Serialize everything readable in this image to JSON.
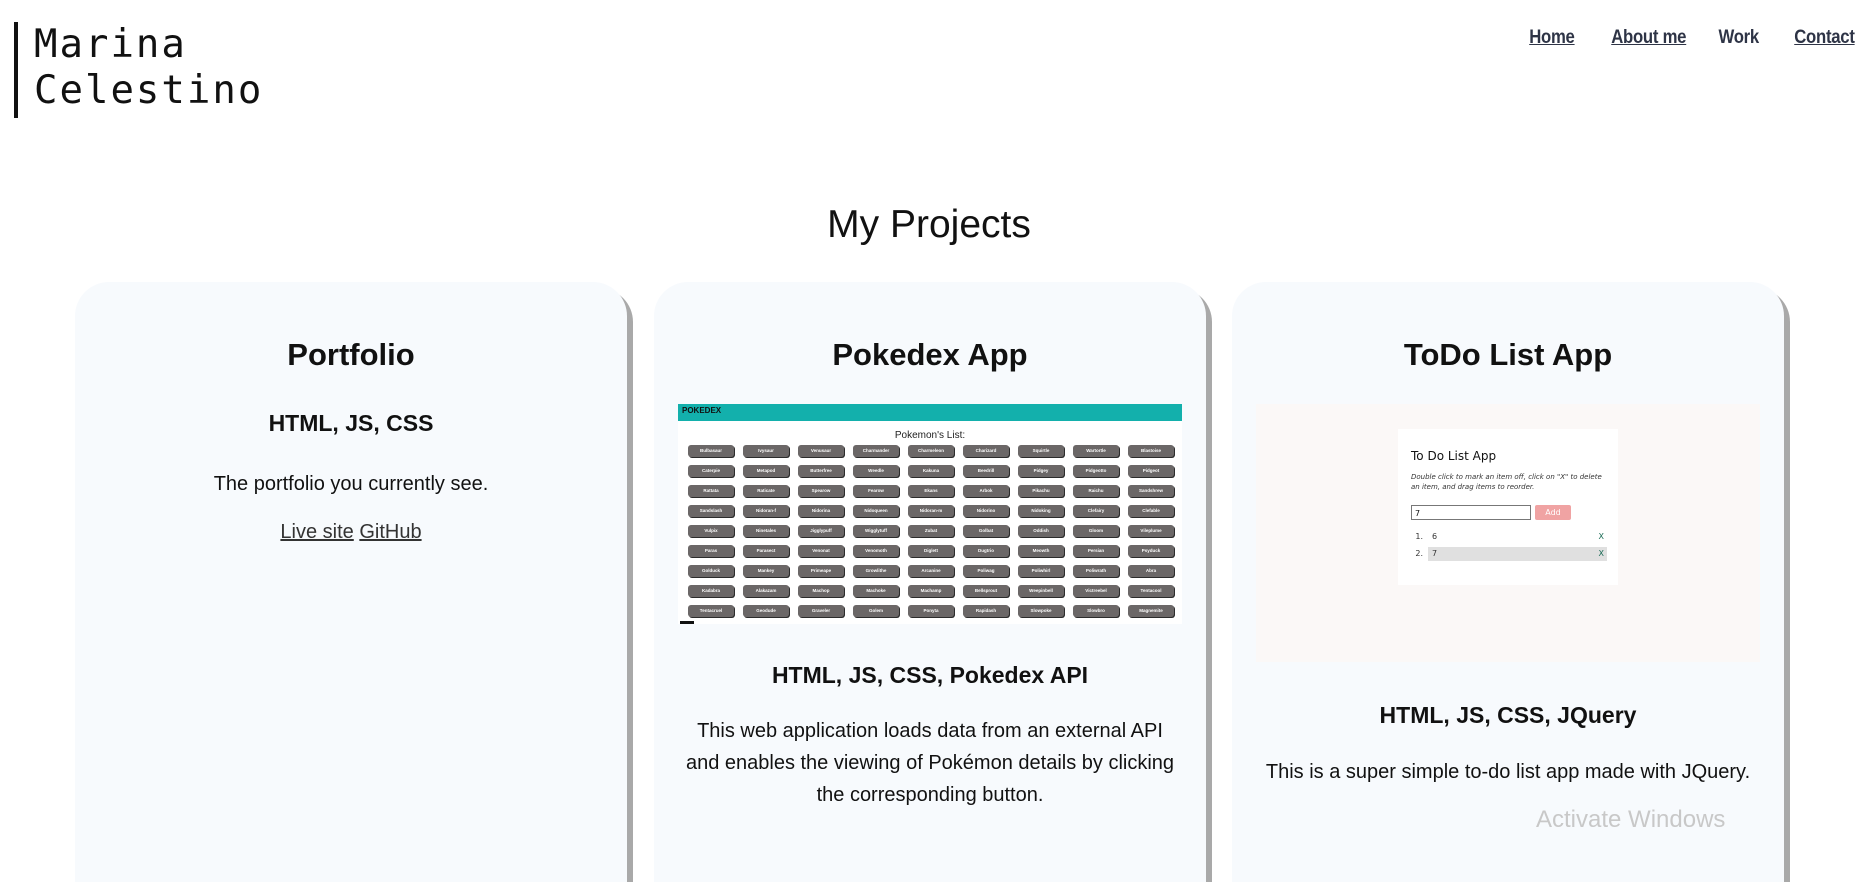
{
  "header": {
    "logo_line1": "Marina",
    "logo_line2": "Celestino",
    "nav": [
      {
        "label": "Home"
      },
      {
        "label": "About me"
      },
      {
        "label": "Work"
      },
      {
        "label": "Contact"
      }
    ]
  },
  "main": {
    "title": "My Projects",
    "projects": [
      {
        "name": "Portfolio",
        "tech": "HTML, JS, CSS",
        "description": "The portfolio you currently see.",
        "live_label": "Live site",
        "github_label": "GitHub"
      },
      {
        "name": "Pokedex App",
        "tech": "HTML, JS, CSS, Pokedex API",
        "description": "This web application loads data from an external API and enables the viewing of Pokémon details by clicking the corresponding button.",
        "screenshot": {
          "bar_label": "POKEDEX",
          "list_title": "Pokemon's List:",
          "pokemon": [
            "Bulbasaur",
            "Ivysaur",
            "Venusaur",
            "Charmander",
            "Charmeleon",
            "Charizard",
            "Squirtle",
            "Wartortle",
            "Blastoise",
            "Caterpie",
            "Metapod",
            "Butterfree",
            "Weedle",
            "Kakuna",
            "Beedrill",
            "Pidgey",
            "Pidgeotto",
            "Pidgeot",
            "Rattata",
            "Raticate",
            "Spearow",
            "Fearow",
            "Ekans",
            "Arbok",
            "Pikachu",
            "Raichu",
            "Sandshrew",
            "Sandslash",
            "Nidoran-f",
            "Nidorina",
            "Nidoqueen",
            "Nidoran-m",
            "Nidorino",
            "Nidoking",
            "Clefairy",
            "Clefable",
            "Vulpix",
            "Ninetales",
            "Jigglypuff",
            "Wigglytuff",
            "Zubat",
            "Golbat",
            "Oddish",
            "Gloom",
            "Vileplume",
            "Paras",
            "Parasect",
            "Venonat",
            "Venomoth",
            "Diglett",
            "Dugtrio",
            "Meowth",
            "Persian",
            "Psyduck",
            "Golduck",
            "Mankey",
            "Primeape",
            "Growlithe",
            "Arcanine",
            "Poliwag",
            "Poliwhirl",
            "Poliwrath",
            "Abra",
            "Kadabra",
            "Alakazam",
            "Machop",
            "Machoke",
            "Machamp",
            "Bellsprout",
            "Weepinbell",
            "Victreebel",
            "Tentacool",
            "Tentacruel",
            "Geodude",
            "Graveler",
            "Golem",
            "Ponyta",
            "Rapidash",
            "Slowpoke",
            "Slowbro",
            "Magnemite"
          ]
        }
      },
      {
        "name": "ToDo List App",
        "tech": "HTML, JS, CSS, JQuery",
        "description": "This is a super simple to-do list app made with JQuery.",
        "screenshot": {
          "title": "To Do List App",
          "instructions": "Double click to mark an item off, click on \"X\" to delete an item, and drag items to reorder.",
          "input_value": "7",
          "add_label": "Add",
          "items": [
            {
              "num": "1.",
              "value": "6",
              "x": "X"
            },
            {
              "num": "2.",
              "value": "7",
              "x": "X"
            }
          ]
        }
      }
    ]
  },
  "overlay": {
    "watermark": "Activate Windows"
  }
}
